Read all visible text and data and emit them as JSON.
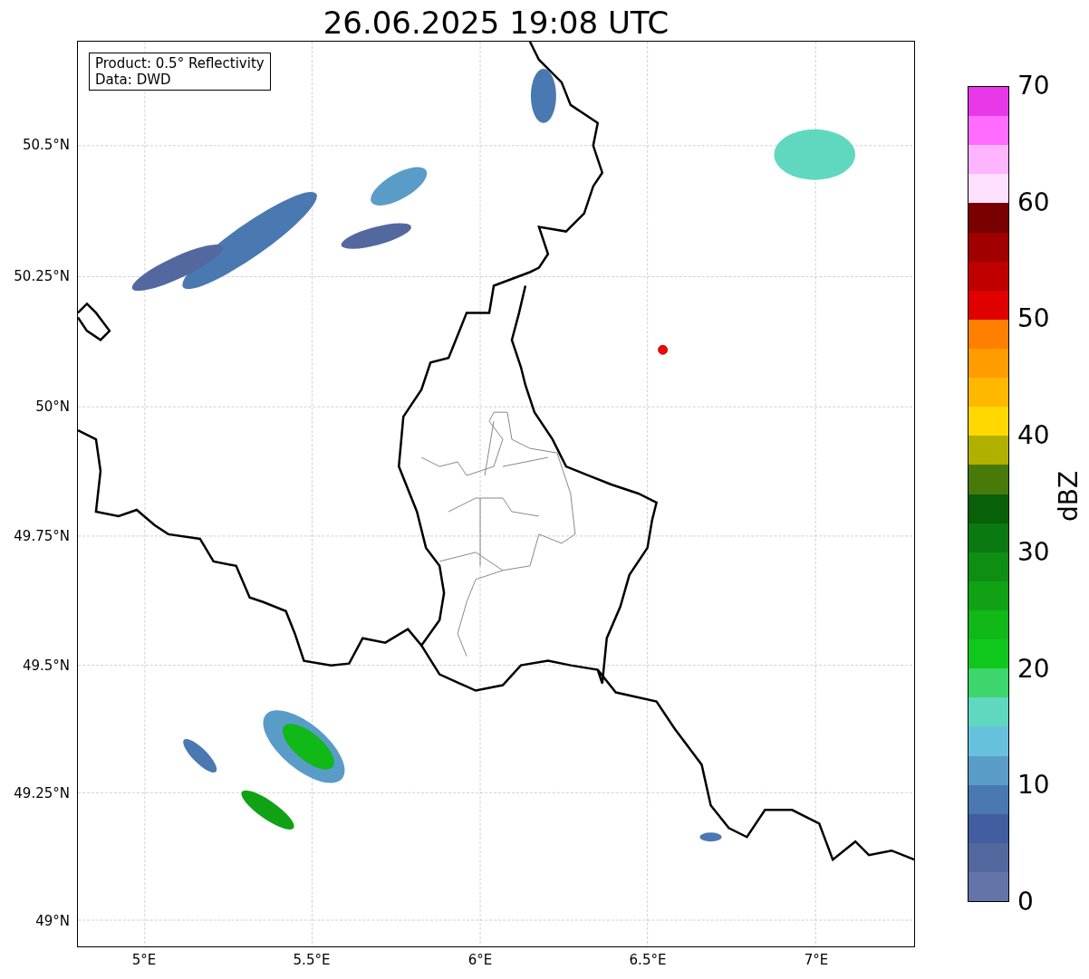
{
  "title": "26.06.2025 19:08 UTC",
  "legend": [
    "Product: 0.5° Reflectivity",
    "Data: DWD"
  ],
  "y_ticks": [
    "50.5°N",
    "50.25°N",
    "50°N",
    "49.75°N",
    "49.5°N",
    "49.25°N",
    "49°N"
  ],
  "x_ticks": [
    "5°E",
    "5.5°E",
    "6°E",
    "6.5°E",
    "7°E"
  ],
  "colorbar": {
    "label": "dBZ",
    "ticks": [
      "70",
      "60",
      "50",
      "40",
      "30",
      "20",
      "10",
      "0"
    ],
    "segments": [
      {
        "color": "#e838e8"
      },
      {
        "color": "#ff6cff"
      },
      {
        "color": "#ffb4ff"
      },
      {
        "color": "#ffe0ff"
      },
      {
        "color": "#780000"
      },
      {
        "color": "#a00000"
      },
      {
        "color": "#c00000"
      },
      {
        "color": "#e00000"
      },
      {
        "color": "#ff8000"
      },
      {
        "color": "#ff9c00"
      },
      {
        "color": "#ffb800"
      },
      {
        "color": "#ffd800"
      },
      {
        "color": "#b0b000"
      },
      {
        "color": "#487a0a"
      },
      {
        "color": "#086008"
      },
      {
        "color": "#0a7a10"
      },
      {
        "color": "#0e8e12"
      },
      {
        "color": "#10a214"
      },
      {
        "color": "#10b818"
      },
      {
        "color": "#10c81c"
      },
      {
        "color": "#3cd66c"
      },
      {
        "color": "#60d8c0"
      },
      {
        "color": "#66c2dc"
      },
      {
        "color": "#5a9cc8"
      },
      {
        "color": "#4a78b0"
      },
      {
        "color": "#425da0"
      },
      {
        "color": "#5468a0"
      },
      {
        "color": "#6474a8"
      }
    ]
  }
}
